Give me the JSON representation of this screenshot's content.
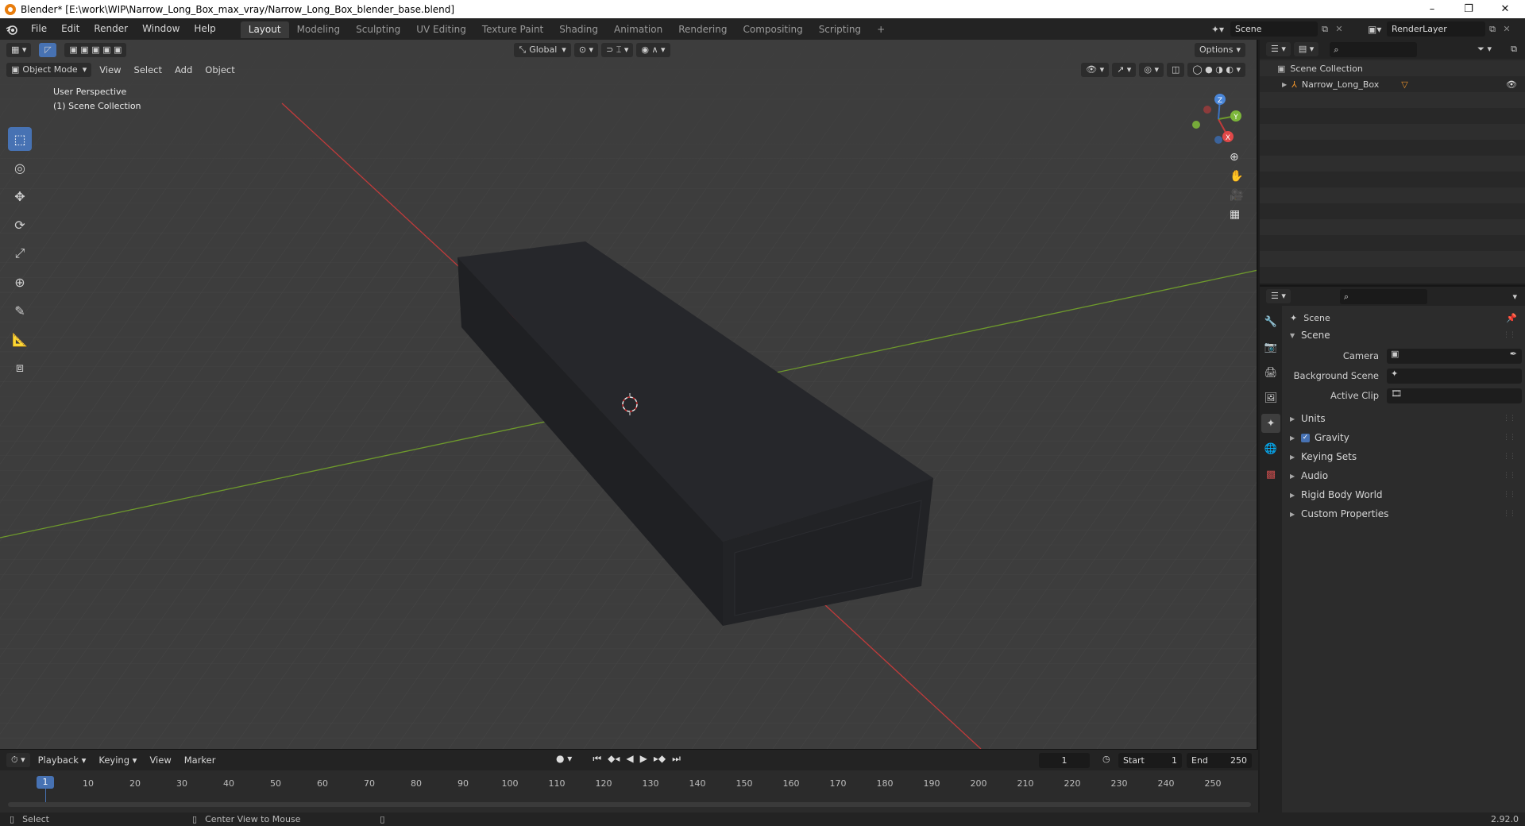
{
  "window": {
    "title": "Blender* [E:\\work\\WIP\\Narrow_Long_Box_max_vray/Narrow_Long_Box_blender_base.blend]",
    "minimize": "–",
    "maximize": "❐",
    "close": "✕"
  },
  "menus": [
    "File",
    "Edit",
    "Render",
    "Window",
    "Help"
  ],
  "workspaces": [
    "Layout",
    "Modeling",
    "Sculpting",
    "UV Editing",
    "Texture Paint",
    "Shading",
    "Animation",
    "Rendering",
    "Compositing",
    "Scripting"
  ],
  "active_workspace": "Layout",
  "add_workspace": "+",
  "scene_field": "Scene",
  "renderlayer_field": "RenderLayer",
  "viewport": {
    "orientation": "Global",
    "options": "Options",
    "mode": "Object Mode",
    "menus": [
      "View",
      "Select",
      "Add",
      "Object"
    ],
    "overlay_line1": "User Perspective",
    "overlay_line2": "(1) Scene Collection",
    "gizmo": {
      "x": "X",
      "y": "Y",
      "z": "Z"
    }
  },
  "tools": [
    "select-box-icon",
    "cursor-icon",
    "move-icon",
    "rotate-icon",
    "scale-icon",
    "transform-icon",
    "annotate-icon",
    "measure-icon",
    "add-cube-icon"
  ],
  "outliner": {
    "root": "Scene Collection",
    "items": [
      {
        "label": "Narrow_Long_Box"
      }
    ]
  },
  "properties": {
    "context": "Scene",
    "panel": "Scene",
    "rows": [
      {
        "label": "Camera"
      },
      {
        "label": "Background Scene"
      },
      {
        "label": "Active Clip"
      }
    ],
    "subpanels": [
      "Units",
      "Gravity",
      "Keying Sets",
      "Audio",
      "Rigid Body World",
      "Custom Properties"
    ],
    "gravity_checked": true
  },
  "timeline": {
    "menus": [
      "Playback",
      "Keying",
      "View",
      "Marker"
    ],
    "current_frame": "1",
    "start_label": "Start",
    "start": "1",
    "end_label": "End",
    "end": "250",
    "ruler": [
      "1",
      "10",
      "20",
      "30",
      "40",
      "50",
      "60",
      "70",
      "80",
      "90",
      "100",
      "110",
      "120",
      "130",
      "140",
      "150",
      "160",
      "170",
      "180",
      "190",
      "200",
      "210",
      "220",
      "230",
      "240",
      "250"
    ]
  },
  "statusbar": {
    "left": "Select",
    "middle": "Center View to Mouse",
    "version": "2.92.0"
  },
  "colors": {
    "accent": "#4772b3",
    "x_axis": "#c13b3b",
    "y_axis": "#6e9a2c",
    "viewport_bg": "#3d3d3d"
  }
}
